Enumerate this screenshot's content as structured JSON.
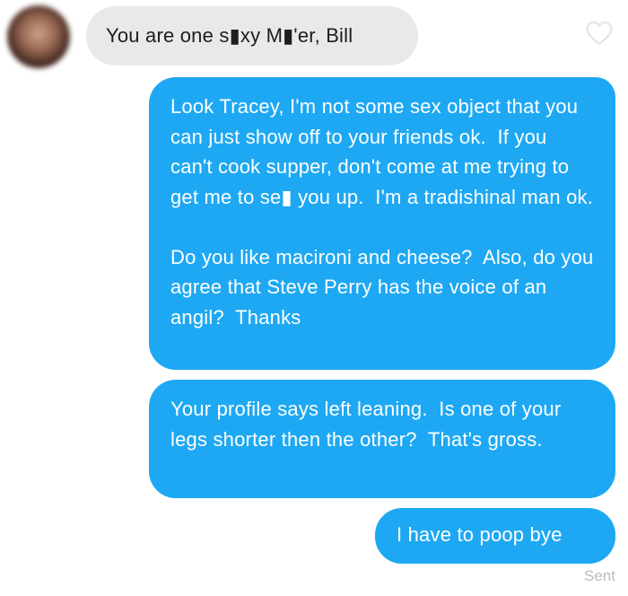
{
  "conversation": {
    "incoming_message": "You are one s▮xy M▮'er, Bill",
    "outgoing_messages": [
      "Look Tracey, I'm not some sex object that you can just show off to your friends ok.  If you can't cook supper, don't come at me trying to get me to se▮ you up.  I'm a tradishinal man ok.\n\nDo you like macironi and cheese?  Also, do you agree that Steve Perry has the voice of an angil?  Thanks",
      "Your profile says left leaning.  Is one of your legs shorter then the other?  That's gross.",
      "I have to poop bye"
    ],
    "status": "Sent"
  },
  "icons": {
    "like": "heart-outline-icon"
  },
  "colors": {
    "outgoing_bubble": "#1ea8f3",
    "incoming_bubble": "#e9e9eb",
    "status_text": "#b8bcc2"
  }
}
